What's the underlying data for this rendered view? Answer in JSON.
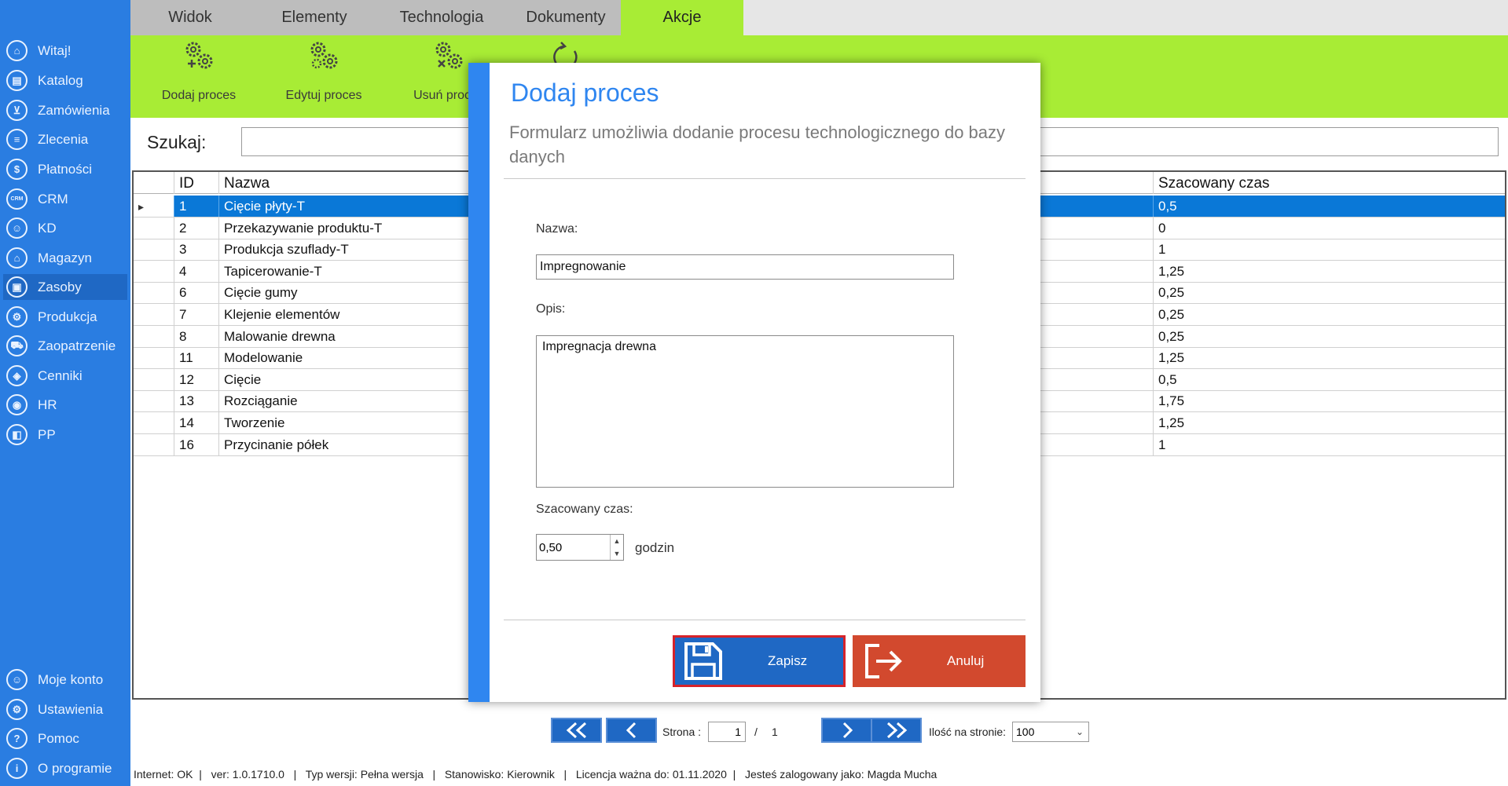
{
  "tabs": [
    {
      "label": "Widok"
    },
    {
      "label": "Elementy"
    },
    {
      "label": "Technologia"
    },
    {
      "label": "Dokumenty"
    },
    {
      "label": "Akcje"
    }
  ],
  "ribbon": {
    "buttons": [
      {
        "label": "Dodaj proces",
        "icon": "gears-add-icon"
      },
      {
        "label": "Edytuj proces",
        "icon": "gears-edit-icon"
      },
      {
        "label": "Usuń proces",
        "icon": "gears-delete-icon"
      },
      {
        "label": "",
        "icon": "refresh-icon"
      }
    ]
  },
  "sidebar": {
    "items": [
      {
        "label": "Witaj!",
        "icon": "home-icon"
      },
      {
        "label": "Katalog",
        "icon": "book-icon"
      },
      {
        "label": "Zamówienia",
        "icon": "cart-icon"
      },
      {
        "label": "Zlecenia",
        "icon": "list-icon"
      },
      {
        "label": "Płatności",
        "icon": "dollar-icon"
      },
      {
        "label": "CRM",
        "icon": "crm-icon"
      },
      {
        "label": "KD",
        "icon": "person-icon"
      },
      {
        "label": "Magazyn",
        "icon": "warehouse-icon"
      },
      {
        "label": "Zasoby",
        "icon": "resources-icon"
      },
      {
        "label": "Produkcja",
        "icon": "production-icon"
      },
      {
        "label": "Zaopatrzenie",
        "icon": "truck-icon"
      },
      {
        "label": "Cenniki",
        "icon": "tag-icon"
      },
      {
        "label": "HR",
        "icon": "hr-icon"
      },
      {
        "label": "PP",
        "icon": "pp-icon"
      }
    ],
    "bottom_items": [
      {
        "label": "Moje konto",
        "icon": "user-icon"
      },
      {
        "label": "Ustawienia",
        "icon": "gear-icon"
      },
      {
        "label": "Pomoc",
        "icon": "help-icon"
      },
      {
        "label": "O programie",
        "icon": "info-icon"
      }
    ]
  },
  "search": {
    "label": "Szukaj:",
    "value": ""
  },
  "grid": {
    "columns": [
      "ID",
      "Nazwa",
      "Szacowany czas"
    ],
    "rows": [
      {
        "id": "1",
        "name": "Cięcie płyty-T",
        "time": "0,5",
        "selected": true
      },
      {
        "id": "2",
        "name": "Przekazywanie produktu-T",
        "time": "0"
      },
      {
        "id": "3",
        "name": "Produkcja szuflady-T",
        "time": "1"
      },
      {
        "id": "4",
        "name": "Tapicerowanie-T",
        "time": "1,25"
      },
      {
        "id": "6",
        "name": "Cięcie gumy",
        "time": "0,25"
      },
      {
        "id": "7",
        "name": "Klejenie elementów",
        "time": "0,25"
      },
      {
        "id": "8",
        "name": "Malowanie drewna",
        "time": "0,25"
      },
      {
        "id": "11",
        "name": "Modelowanie",
        "time": "1,25"
      },
      {
        "id": "12",
        "name": "Cięcie",
        "time": "0,5"
      },
      {
        "id": "13",
        "name": "Rozciąganie",
        "time": "1,75"
      },
      {
        "id": "14",
        "name": "Tworzenie",
        "time": "1,25"
      },
      {
        "id": "16",
        "name": "Przycinanie półek",
        "time": "1"
      }
    ]
  },
  "pager": {
    "page_label": "Strona :",
    "page": "1",
    "separator": "/",
    "total": "1",
    "per_page_label": "Ilość na stronie:",
    "per_page": "100"
  },
  "status": {
    "text": "Internet: OK  |   ver: 1.0.1710.0   |   Typ wersji: Pełna wersja   |   Stanowisko: Kierownik   |   Licencja ważna do: 01.11.2020  |   Jesteś zalogowany jako: Magda Mucha"
  },
  "dialog": {
    "title": "Dodaj proces",
    "subtitle": "Formularz umożliwia dodanie procesu technologicznego do bazy danych",
    "name_label": "Nazwa:",
    "name_value": "Impregnowanie",
    "desc_label": "Opis:",
    "desc_value": "Impregnacja drewna",
    "time_label": "Szacowany czas:",
    "time_value": "0,50",
    "time_unit": "godzin",
    "save_label": "Zapisz",
    "cancel_label": "Anuluj"
  },
  "colors": {
    "sidebar": "#2a7de1",
    "ribbon": "#a8ec35",
    "accent": "#2f86f0",
    "selection": "#0a78d7",
    "cancel": "#d2492e"
  }
}
